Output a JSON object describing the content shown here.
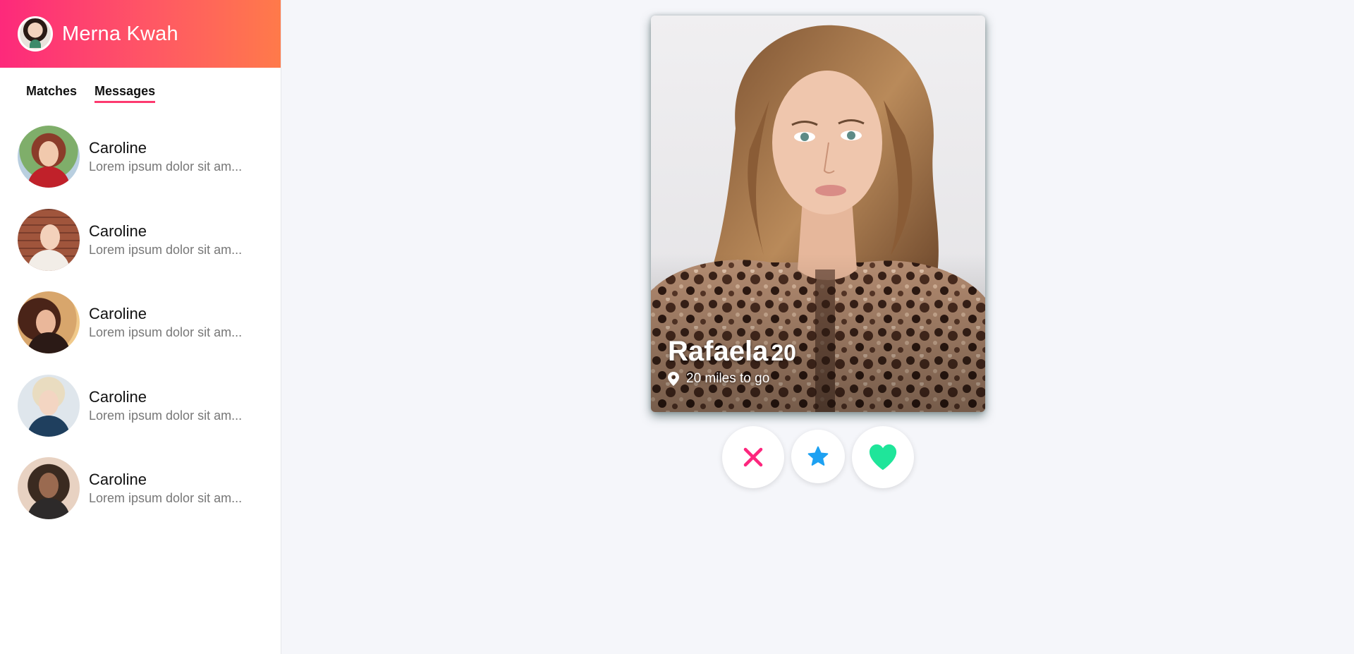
{
  "user": {
    "name": "Merna Kwah",
    "avatar_icon": "user-avatar"
  },
  "tabs": [
    {
      "label": "Matches",
      "active": false
    },
    {
      "label": "Messages",
      "active": true
    }
  ],
  "messages": [
    {
      "name": "Caroline",
      "preview": "Lorem ipsum dolor sit am...",
      "avatar": "avatar-photo-1"
    },
    {
      "name": "Caroline",
      "preview": "Lorem ipsum dolor sit am...",
      "avatar": "avatar-photo-2"
    },
    {
      "name": "Caroline",
      "preview": "Lorem ipsum dolor sit am...",
      "avatar": "avatar-photo-3"
    },
    {
      "name": "Caroline",
      "preview": "Lorem ipsum dolor sit am...",
      "avatar": "avatar-photo-4"
    },
    {
      "name": "Caroline",
      "preview": "Lorem ipsum dolor sit am...",
      "avatar": "avatar-photo-5"
    }
  ],
  "profile_card": {
    "name": "Rafaela",
    "age": "20",
    "distance": "20 miles to go"
  },
  "actions": {
    "nope_icon": "close-icon",
    "superlike_icon": "star-icon",
    "like_icon": "heart-icon"
  },
  "colors": {
    "brand_gradient_start": "#fd297b",
    "brand_gradient_end": "#ff7a4a",
    "nope": "#fd267d",
    "superlike": "#1da1f2",
    "like": "#1fe59a",
    "tab_underline": "#fd3a6f"
  }
}
